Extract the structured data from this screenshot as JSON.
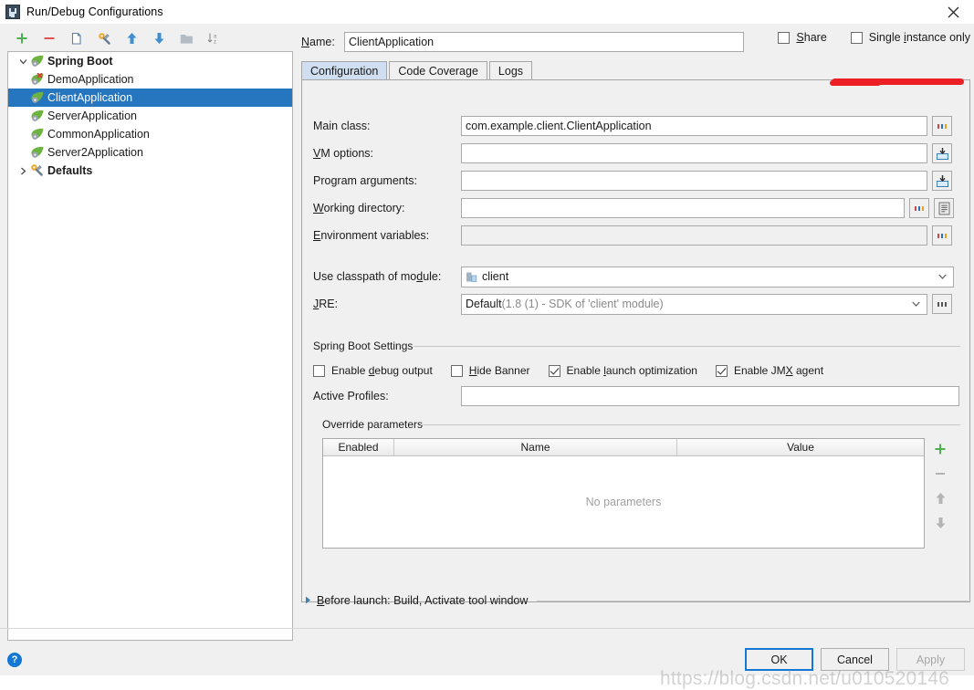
{
  "window": {
    "title": "Run/Debug Configurations",
    "icon": "intellij-idea-logo",
    "close_label": "✕"
  },
  "tree_toolbar": {
    "buttons": [
      {
        "name": "add",
        "icon": "plus-icon",
        "color": "#4caf50"
      },
      {
        "name": "remove",
        "icon": "minus-icon",
        "color": "#e05252"
      },
      {
        "name": "copy",
        "icon": "copy-icon",
        "color": "#5b7fa6"
      },
      {
        "name": "edit-templates",
        "icon": "wrench-icon",
        "color": "#f0a82a"
      },
      {
        "name": "move-up",
        "icon": "arrow-up-icon",
        "color": "#3e8ed0"
      },
      {
        "name": "move-down",
        "icon": "arrow-down-icon",
        "color": "#3e8ed0"
      },
      {
        "name": "new-folder",
        "icon": "folder-icon",
        "color": "#9aa3ab"
      },
      {
        "name": "sort-alphabetically",
        "icon": "sort-az-icon",
        "color": "#8a8a8a"
      }
    ]
  },
  "tree": {
    "items": [
      {
        "label": "Spring Boot",
        "level": 0,
        "expanded": true,
        "bold": true,
        "icon": "spring-leaf-icon",
        "selected": false,
        "error": false
      },
      {
        "label": "DemoApplication",
        "level": 1,
        "expanded": null,
        "bold": false,
        "icon": "spring-leaf-icon",
        "selected": false,
        "error": true
      },
      {
        "label": "ClientApplication",
        "level": 1,
        "expanded": null,
        "bold": false,
        "icon": "spring-leaf-icon",
        "selected": true,
        "error": false
      },
      {
        "label": "ServerApplication",
        "level": 1,
        "expanded": null,
        "bold": false,
        "icon": "spring-leaf-icon",
        "selected": false,
        "error": false
      },
      {
        "label": "CommonApplication",
        "level": 1,
        "expanded": null,
        "bold": false,
        "icon": "spring-leaf-icon",
        "selected": false,
        "error": false
      },
      {
        "label": "Server2Application",
        "level": 1,
        "expanded": null,
        "bold": false,
        "icon": "spring-leaf-icon",
        "selected": false,
        "error": false
      },
      {
        "label": "Defaults",
        "level": 0,
        "expanded": false,
        "bold": true,
        "icon": "wrench-icon",
        "selected": false,
        "error": false
      }
    ],
    "selection_color": "#2675bf"
  },
  "name_field": {
    "label": "Name:",
    "mnemonic": "N",
    "value": "ClientApplication",
    "placeholder": ""
  },
  "options": {
    "share": {
      "label": "Share",
      "mnemonic": "S",
      "checked": false
    },
    "single_instance": {
      "label": "Single instance only",
      "mnemonic": "i",
      "checked": false
    }
  },
  "annotation": {
    "type": "red-underline",
    "color": "#ec2024",
    "target": "Single instance only"
  },
  "tabs": [
    {
      "label": "Configuration",
      "active": true
    },
    {
      "label": "Code Coverage",
      "active": false
    },
    {
      "label": "Logs",
      "active": false
    }
  ],
  "fields": [
    {
      "name": "main-class",
      "label": "Main class:",
      "mnemonic": "",
      "value": "com.example.client.ClientApplication",
      "buttons": [
        "ellipsis-icon"
      ],
      "disabled": false
    },
    {
      "name": "vm-options",
      "label": "VM options:",
      "mnemonic": "V",
      "value": "",
      "buttons": [
        "expand-macro-icon"
      ],
      "disabled": false
    },
    {
      "name": "program-arguments",
      "label": "Program arguments:",
      "mnemonic": "g",
      "value": "",
      "buttons": [
        "expand-macro-icon"
      ],
      "disabled": false
    },
    {
      "name": "working-directory",
      "label": "Working directory:",
      "mnemonic": "W",
      "value": "",
      "buttons": [
        "ellipsis-icon",
        "macro-list-icon"
      ],
      "disabled": false
    },
    {
      "name": "environment-variables",
      "label": "Environment variables:",
      "mnemonic": "E",
      "value": "",
      "buttons": [
        "ellipsis-icon"
      ],
      "disabled": true
    }
  ],
  "classpath": {
    "label": "Use classpath of module:",
    "mnemonic": "d",
    "value": "client",
    "icon": "module-icon"
  },
  "jre": {
    "label": "JRE:",
    "mnemonic": "J",
    "value": "Default",
    "detail": " (1.8 (1) - SDK of 'client' module)",
    "buttons": [
      "ellipsis-icon"
    ]
  },
  "spring_boot_settings": {
    "title": "Spring Boot Settings",
    "checkboxes": [
      {
        "label": "Enable debug output",
        "mnemonic": "d",
        "checked": false
      },
      {
        "label": "Hide Banner",
        "mnemonic": "H",
        "checked": false
      },
      {
        "label": "Enable launch optimization",
        "mnemonic": "l",
        "checked": true
      },
      {
        "label": "Enable JMX agent",
        "mnemonic": "X",
        "checked": true
      }
    ],
    "active_profiles": {
      "label": "Active Profiles:",
      "value": "",
      "placeholder": ""
    }
  },
  "override_parameters": {
    "title": "Override parameters",
    "columns": [
      "Enabled",
      "Name",
      "Value"
    ],
    "rows": [],
    "empty_text": "No parameters",
    "side_buttons": [
      {
        "name": "add-parameter",
        "icon": "plus-icon",
        "enabled": true
      },
      {
        "name": "remove-parameter",
        "icon": "minus-icon",
        "enabled": false
      },
      {
        "name": "move-parameter-up",
        "icon": "arrow-up-icon",
        "enabled": false
      },
      {
        "name": "move-parameter-down",
        "icon": "arrow-down-icon",
        "enabled": false
      }
    ]
  },
  "before_launch": {
    "label": "Before launch: Build, Activate tool window",
    "mnemonic": "B",
    "expanded": false
  },
  "footer": {
    "help": "?",
    "buttons": [
      {
        "label": "OK",
        "name": "ok-button",
        "default": true,
        "enabled": true
      },
      {
        "label": "Cancel",
        "name": "cancel-button",
        "default": false,
        "enabled": true
      },
      {
        "label": "Apply",
        "name": "apply-button",
        "default": false,
        "enabled": false
      }
    ]
  },
  "watermark": "https://blog.csdn.net/u010520146"
}
